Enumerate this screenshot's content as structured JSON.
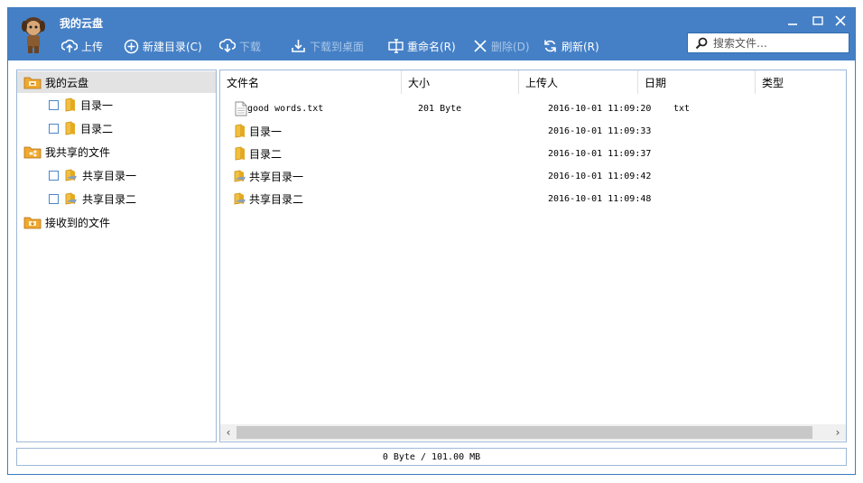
{
  "app": {
    "title": "我的云盘"
  },
  "toolbar": {
    "upload": "上传",
    "new_folder": "新建目录(C)",
    "download": "下载",
    "download_desktop": "下载到桌面",
    "rename": "重命名(R)",
    "delete": "删除(D)",
    "refresh": "刷新(R)"
  },
  "search": {
    "placeholder": "搜索文件…"
  },
  "tree": {
    "my_cloud": "我的云盘",
    "dir1": "目录一",
    "dir2": "目录二",
    "my_shared": "我共享的文件",
    "shared_dir1": "共享目录一",
    "shared_dir2": "共享目录二",
    "received": "接收到的文件"
  },
  "columns": {
    "name": "文件名",
    "size": "大小",
    "uploader": "上传人",
    "date": "日期",
    "type": "类型"
  },
  "files": [
    {
      "name": "good words.txt",
      "size": "201 Byte",
      "uploader": "",
      "date": "2016-10-01 11:09:20",
      "type": "txt",
      "icon": "text-file-icon"
    },
    {
      "name": "目录一",
      "size": "",
      "uploader": "",
      "date": "2016-10-01 11:09:33",
      "type": "",
      "icon": "folder-icon"
    },
    {
      "name": "目录二",
      "size": "",
      "uploader": "",
      "date": "2016-10-01 11:09:37",
      "type": "",
      "icon": "folder-icon"
    },
    {
      "name": "共享目录一",
      "size": "",
      "uploader": "",
      "date": "2016-10-01 11:09:42",
      "type": "",
      "icon": "shared-folder-icon"
    },
    {
      "name": "共享目录二",
      "size": "",
      "uploader": "",
      "date": "2016-10-01 11:09:48",
      "type": "",
      "icon": "shared-folder-icon"
    }
  ],
  "status": {
    "usage": "0 Byte / 101.00 MB"
  },
  "colors": {
    "header": "#4580c6",
    "border": "#9eb9d8",
    "selected": "#e3e3e3"
  }
}
